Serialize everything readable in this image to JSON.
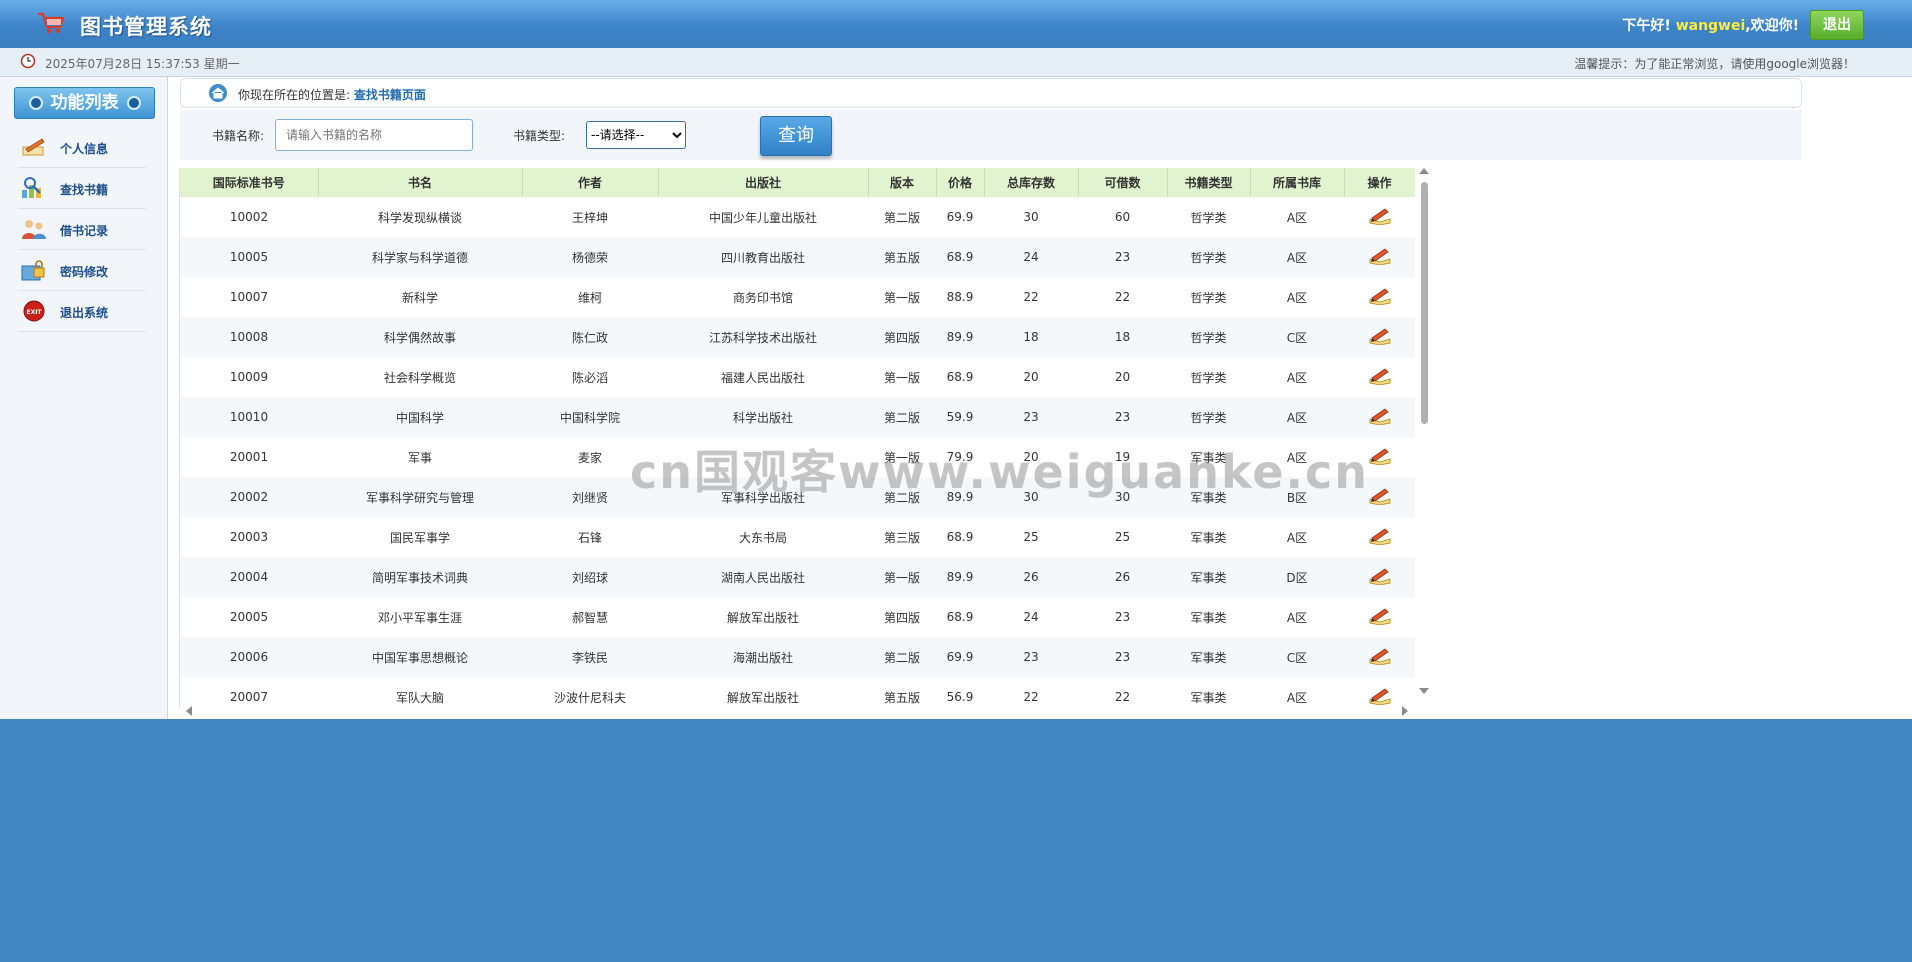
{
  "header": {
    "title": "图书管理系统",
    "greeting_prefix": "下午好!",
    "username": "wangwei",
    "greeting_suffix": ",欢迎你!",
    "logout_label": "退出"
  },
  "statusbar": {
    "datetime": "2025年07月28日 15:37:53 星期一",
    "tip": "温馨提示：为了能正常浏览，请使用google浏览器！"
  },
  "sidebar": {
    "title": "功能列表",
    "items": [
      {
        "label": "个人信息",
        "icon": "pencil-paper-icon"
      },
      {
        "label": "查找书籍",
        "icon": "search-chart-icon"
      },
      {
        "label": "借书记录",
        "icon": "users-icon"
      },
      {
        "label": "密码修改",
        "icon": "password-icon"
      },
      {
        "label": "退出系统",
        "icon": "exit-icon"
      }
    ]
  },
  "breadcrumb": {
    "prefix": "你现在所在的位置是:",
    "current": "查找书籍页面"
  },
  "search": {
    "name_label": "书籍名称:",
    "name_placeholder": "请输入书籍的名称",
    "type_label": "书籍类型:",
    "type_selected": "--请选择--",
    "query_label": "查询"
  },
  "table": {
    "columns": [
      "国际标准书号",
      "书名",
      "作者",
      "出版社",
      "版本",
      "价格",
      "总库存数",
      "可借数",
      "书籍类型",
      "所属书库",
      "操作"
    ],
    "rows": [
      [
        "10002",
        "科学发现纵横谈",
        "王梓坤",
        "中国少年儿童出版社",
        "第二版",
        "69.9",
        "30",
        "60",
        "哲学类",
        "A区"
      ],
      [
        "10005",
        "科学家与科学道德",
        "杨德荣",
        "四川教育出版社",
        "第五版",
        "68.9",
        "24",
        "23",
        "哲学类",
        "A区"
      ],
      [
        "10007",
        "新科学",
        "维柯",
        "商务印书馆",
        "第一版",
        "88.9",
        "22",
        "22",
        "哲学类",
        "A区"
      ],
      [
        "10008",
        "科学偶然故事",
        "陈仁政",
        "江苏科学技术出版社",
        "第四版",
        "89.9",
        "18",
        "18",
        "哲学类",
        "C区"
      ],
      [
        "10009",
        "社会科学概览",
        "陈必滔",
        "福建人民出版社",
        "第一版",
        "68.9",
        "20",
        "20",
        "哲学类",
        "A区"
      ],
      [
        "10010",
        "中国科学",
        "中国科学院",
        "科学出版社",
        "第二版",
        "59.9",
        "23",
        "23",
        "哲学类",
        "A区"
      ],
      [
        "20001",
        "军事",
        "麦家",
        "",
        "第一版",
        "79.9",
        "20",
        "19",
        "军事类",
        "A区"
      ],
      [
        "20002",
        "军事科学研究与管理",
        "刘继贤",
        "军事科学出版社",
        "第二版",
        "89.9",
        "30",
        "30",
        "军事类",
        "B区"
      ],
      [
        "20003",
        "国民军事学",
        "石锋",
        "大东书局",
        "第三版",
        "68.9",
        "25",
        "25",
        "军事类",
        "A区"
      ],
      [
        "20004",
        "简明军事技术词典",
        "刘绍球",
        "湖南人民出版社",
        "第一版",
        "89.9",
        "26",
        "26",
        "军事类",
        "D区"
      ],
      [
        "20005",
        "邓小平军事生涯",
        "郝智慧",
        "解放军出版社",
        "第四版",
        "68.9",
        "24",
        "23",
        "军事类",
        "A区"
      ],
      [
        "20006",
        "中国军事思想概论",
        "李铁民",
        "海潮出版社",
        "第二版",
        "69.9",
        "23",
        "23",
        "军事类",
        "C区"
      ],
      [
        "20007",
        "军队大脑",
        "沙波什尼科夫",
        "解放军出版社",
        "第五版",
        "56.9",
        "22",
        "22",
        "军事类",
        "A区"
      ]
    ],
    "row_action_icon": "borrow-book-icon"
  },
  "watermark": "cn国观客www.weiguanke.cn",
  "colors": {
    "header_blue": "#3c83c8",
    "page_blue": "#3f86c3",
    "table_header_green": "#e2f4cf",
    "logout_green": "#57ad2a",
    "username_yellow": "#ffec3d"
  }
}
